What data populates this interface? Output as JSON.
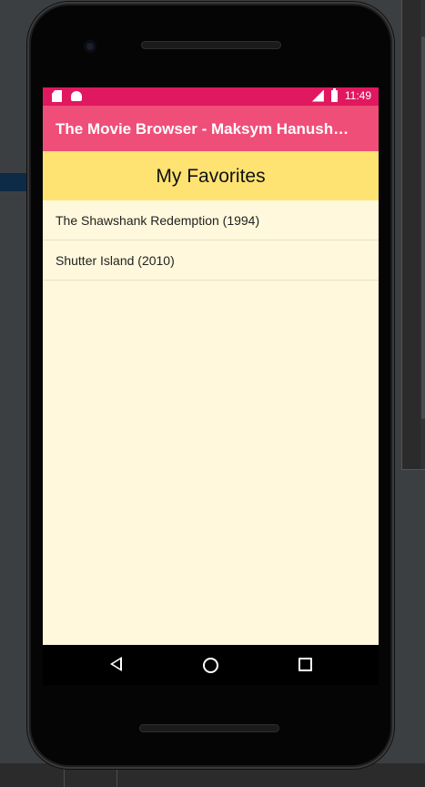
{
  "status_bar": {
    "time": "11:49",
    "icons": [
      "sd-card-icon",
      "android-icon",
      "lte-signal-icon",
      "battery-charging-icon"
    ],
    "color": "#e0185f"
  },
  "app_bar": {
    "title": "The Movie Browser - Maksym Hanush…",
    "color": "#ef4e78"
  },
  "favorites": {
    "heading": "My Favorites",
    "header_color": "#ffe372",
    "background_color": "#fff8dc",
    "movies": [
      {
        "label": "The Shawshank Redemption (1994)"
      },
      {
        "label": "Shutter Island (2010)"
      }
    ]
  },
  "nav_bar": {
    "icons": [
      "back-icon",
      "home-icon",
      "recents-icon"
    ]
  }
}
